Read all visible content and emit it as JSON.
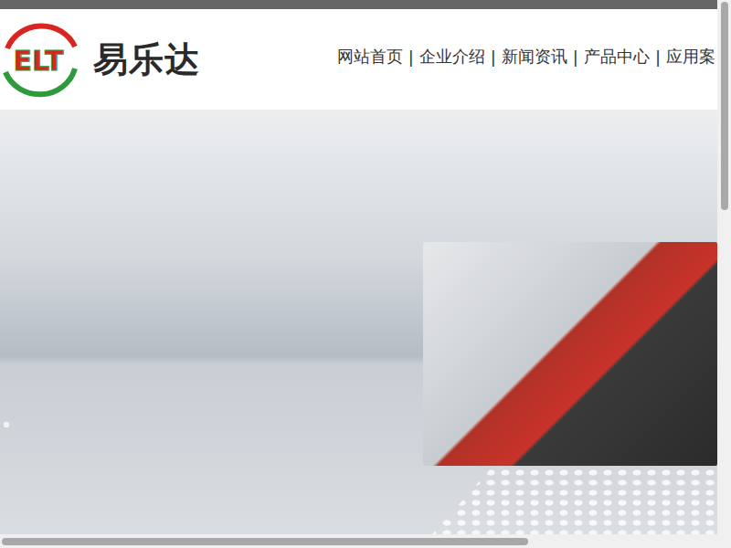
{
  "logo": {
    "mark": "ELT",
    "name": "易乐达"
  },
  "nav": {
    "separator": "|",
    "items": [
      "网站首页",
      "企业介绍",
      "新闻资讯",
      "产品中心",
      "应用案"
    ]
  },
  "banner": {
    "photo": "welding equipment"
  }
}
